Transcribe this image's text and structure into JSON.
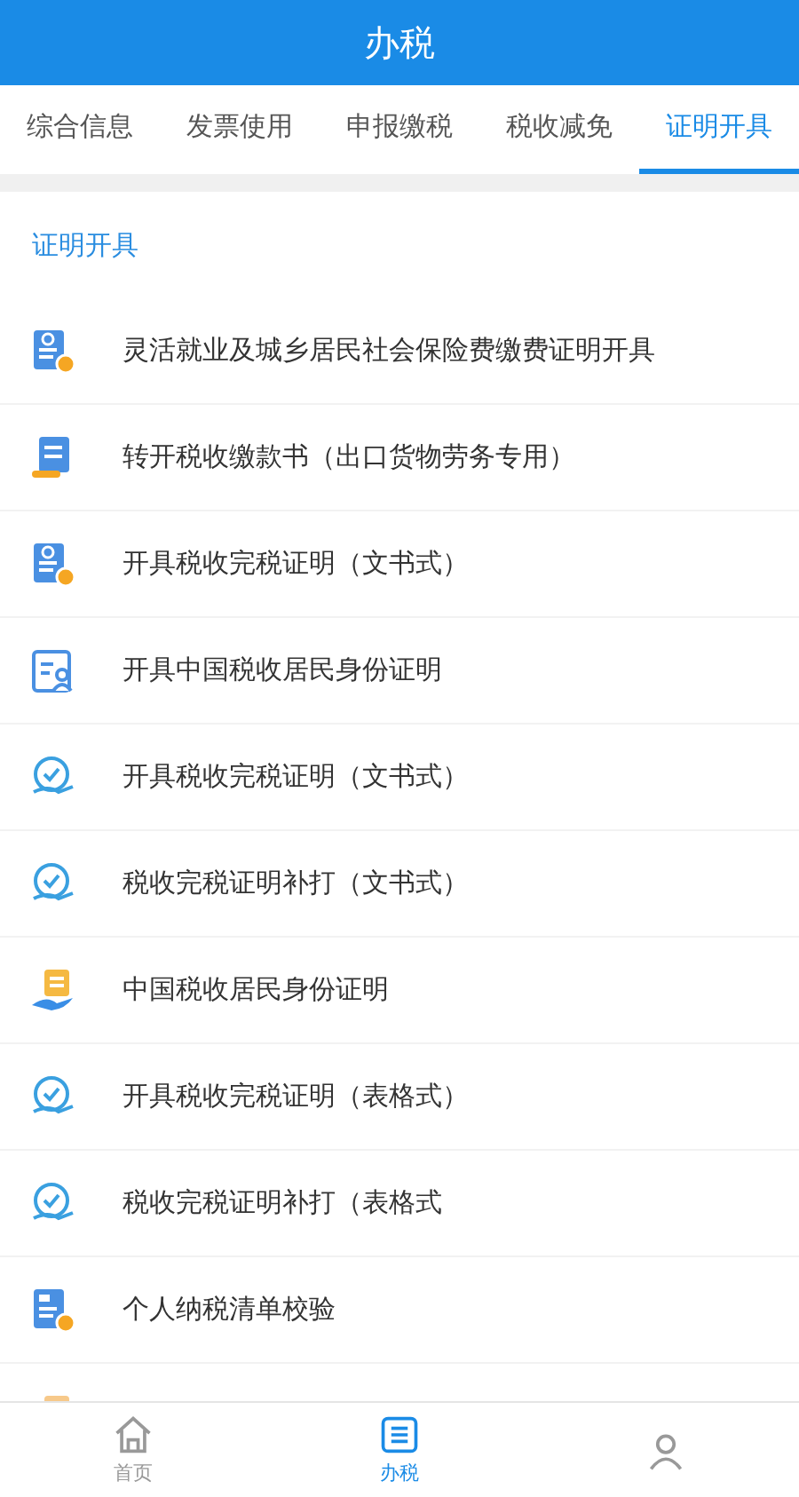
{
  "header": {
    "title": "办税"
  },
  "tabs": [
    {
      "label": "综合信息",
      "selected": false
    },
    {
      "label": "发票使用",
      "selected": false
    },
    {
      "label": "申报缴税",
      "selected": false
    },
    {
      "label": "税收减免",
      "selected": false
    },
    {
      "label": "证明开具",
      "selected": true
    }
  ],
  "section": {
    "title": "证明开具"
  },
  "items": [
    {
      "kind": "doc-badge",
      "label": "灵活就业及城乡居民社会保险费缴费证明开具"
    },
    {
      "kind": "scroll",
      "label": "转开税收缴款书（出口货物劳务专用）"
    },
    {
      "kind": "doc-badge",
      "label": "开具税收完税证明（文书式）"
    },
    {
      "kind": "profile",
      "label": "开具中国税收居民身份证明"
    },
    {
      "kind": "hand-check",
      "label": "开具税收完税证明（文书式）"
    },
    {
      "kind": "hand-check",
      "label": "税收完税证明补打（文书式）"
    },
    {
      "kind": "hand-doc",
      "label": "中国税收居民身份证明"
    },
    {
      "kind": "hand-check",
      "label": "开具税收完税证明（表格式）"
    },
    {
      "kind": "hand-check",
      "label": "税收完税证明补打（表格式"
    },
    {
      "kind": "list-badge",
      "label": "个人纳税清单校验"
    },
    {
      "kind": "hand-doc-orange"
    }
  ],
  "bottom_nav": [
    {
      "kind": "home",
      "label": "首页",
      "selected": false
    },
    {
      "kind": "list",
      "label": "办税",
      "selected": true
    },
    {
      "kind": "person",
      "selected": false
    }
  ]
}
